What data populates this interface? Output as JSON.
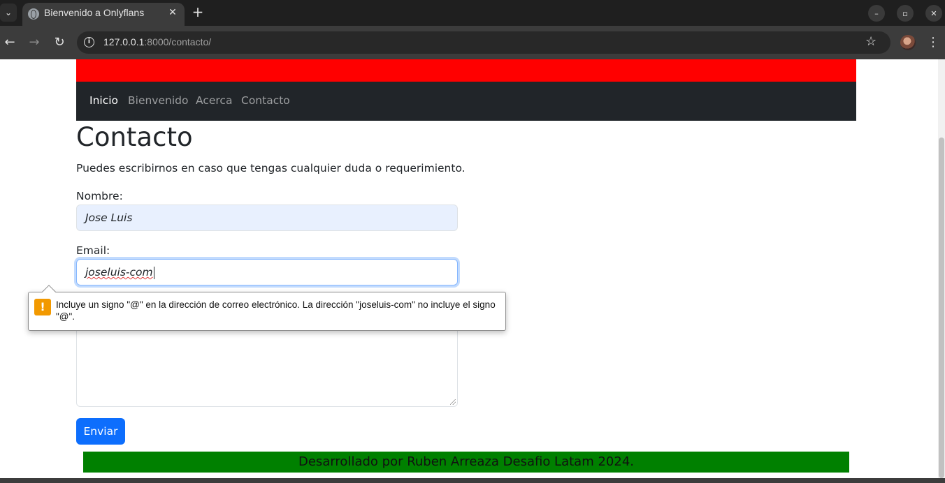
{
  "browser": {
    "tab_title": "Bienvenido a Onlyflans",
    "tab_close_glyph": "✕",
    "new_tab_glyph": "+",
    "tab_list_glyph": "⌄",
    "url_host": "127.0.0.1",
    "url_rest": ":8000/contacto/",
    "window_controls": {
      "minimize": "–",
      "maximize": "▫",
      "close": "✕"
    },
    "nav": {
      "back": "←",
      "forward": "→",
      "reload": "↻"
    },
    "info_glyph": "i",
    "star_glyph": "☆",
    "menu_glyph": "⋮"
  },
  "navbar": {
    "links": [
      "Inicio",
      "Bienvenido",
      "Acerca",
      "Contacto"
    ],
    "active": "Inicio"
  },
  "page": {
    "title": "Contacto",
    "lead": "Puedes escribirnos en caso que tengas cualquier duda o requerimiento."
  },
  "form": {
    "name_label": "Nombre:",
    "name_value": "Jose Luis",
    "email_label": "Email:",
    "email_value": "joseluis-com",
    "submit_label": "Enviar"
  },
  "validation_tooltip": {
    "icon": "!",
    "message": "Incluye un signo \"@\" en la dirección de correo electrónico. La dirección \"joseluis-com\" no incluye el signo \"@\"."
  },
  "footer": {
    "text": "Desarrollado por Ruben Arreaza Desafio Latam 2024."
  },
  "colors": {
    "banner": "#ff0000",
    "navbar": "#212529",
    "footer": "#008000",
    "primary": "#0d6efd",
    "warning": "#f29900"
  }
}
